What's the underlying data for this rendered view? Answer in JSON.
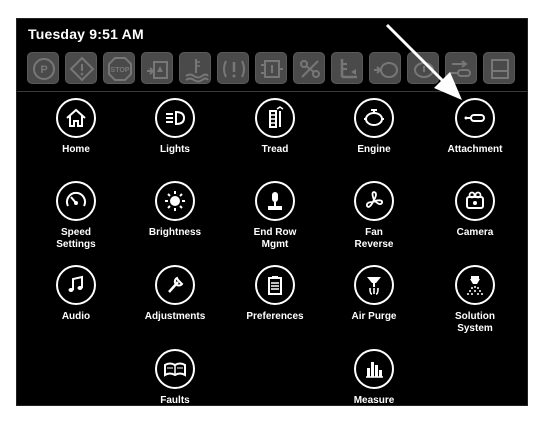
{
  "status": {
    "time": "Tuesday 9:51 AM"
  },
  "warnings": [
    {
      "icon": "park-brake-icon"
    },
    {
      "icon": "general-warning-icon"
    },
    {
      "icon": "stop-icon"
    },
    {
      "icon": "hydraulic-fluid-icon"
    },
    {
      "icon": "coolant-temperature-icon"
    },
    {
      "icon": "brake-warning-icon"
    },
    {
      "icon": "transmission-icon"
    },
    {
      "icon": "drive-fault-icon"
    },
    {
      "icon": "fuel-level-icon"
    },
    {
      "icon": "engine-oil-icon"
    },
    {
      "icon": "engine-fault-icon"
    },
    {
      "icon": "attachment-fault-icon"
    },
    {
      "icon": "tank-level-icon"
    }
  ],
  "menu": {
    "home": "Home",
    "lights": "Lights",
    "tread": "Tread",
    "engine": "Engine",
    "attachment": "Attachment",
    "speed_settings_1": "Speed",
    "speed_settings_2": "Settings",
    "brightness": "Brightness",
    "end_row_1": "End Row",
    "end_row_2": "Mgmt",
    "fan_reverse_1": "Fan",
    "fan_reverse_2": "Reverse",
    "camera": "Camera",
    "audio": "Audio",
    "adjustments": "Adjustments",
    "preferences": "Preferences",
    "air_purge": "Air Purge",
    "solution_1": "Solution",
    "solution_2": "System",
    "faults": "Faults",
    "measure": "Measure"
  }
}
